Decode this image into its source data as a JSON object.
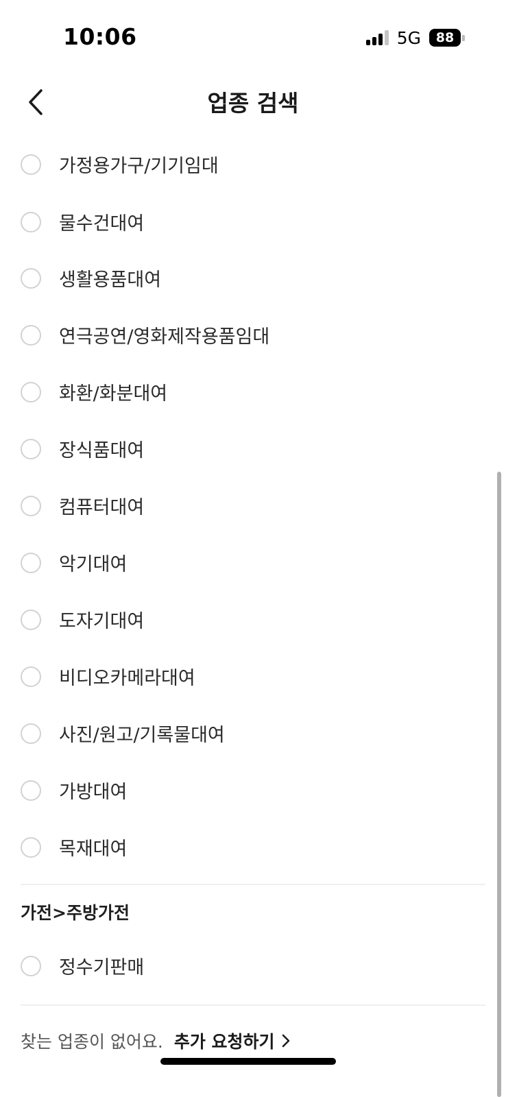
{
  "status_bar": {
    "time": "10:06",
    "network": "5G",
    "battery": "88"
  },
  "header": {
    "title": "업종 검색",
    "back_icon": "chevron-left-icon"
  },
  "items": [
    {
      "label": "가정용가구/기기임대",
      "selected": false
    },
    {
      "label": "물수건대여",
      "selected": false
    },
    {
      "label": "생활용품대여",
      "selected": false
    },
    {
      "label": "연극공연/영화제작용품임대",
      "selected": false
    },
    {
      "label": "화환/화분대여",
      "selected": false
    },
    {
      "label": "장식품대여",
      "selected": false
    },
    {
      "label": "컴퓨터대여",
      "selected": false
    },
    {
      "label": "악기대여",
      "selected": false
    },
    {
      "label": "도자기대여",
      "selected": false
    },
    {
      "label": "비디오카메라대여",
      "selected": false
    },
    {
      "label": "사진/원고/기록물대여",
      "selected": false
    },
    {
      "label": "가방대여",
      "selected": false
    },
    {
      "label": "목재대여",
      "selected": false
    }
  ],
  "section2": {
    "title": "가전>주방가전",
    "items": [
      {
        "label": "정수기판매",
        "selected": false
      }
    ]
  },
  "footer": {
    "text": "찾는 업종이 없어요.",
    "link": "추가 요청하기",
    "link_icon": "chevron-right-icon"
  },
  "colors": {
    "radio_border": "#d2d2d2",
    "divider": "#efefef",
    "text": "#2a2a2a"
  }
}
